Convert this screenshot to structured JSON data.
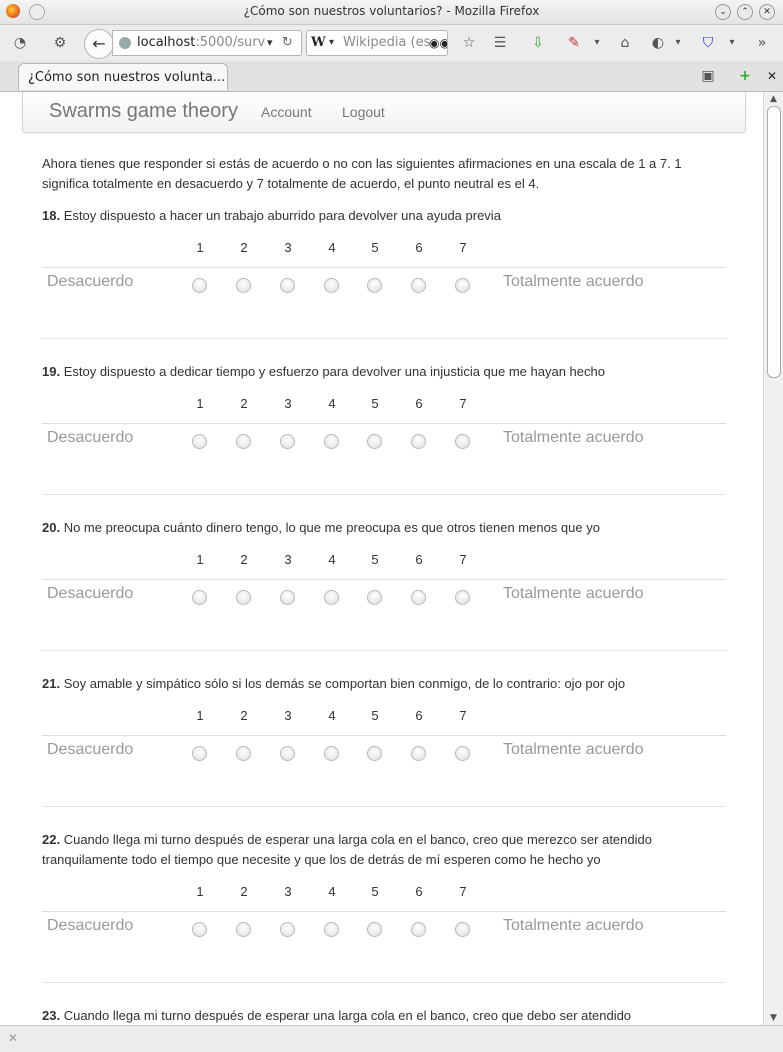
{
  "window": {
    "title": "¿Cómo son nuestros voluntarios? - Mozilla Firefox",
    "btn_min": "⌄",
    "btn_max": "⌃",
    "btn_close": "✕"
  },
  "toolbar": {
    "url_host": "localhost",
    "url_path": ":5000/surv",
    "search_engine": "W",
    "search_placeholder": "Wikipedia (es",
    "back_glyph": "←",
    "reload_glyph": "↻",
    "overflow_glyph": "»"
  },
  "tab": {
    "label": "¿Cómo son nuestros volunta...",
    "close_glyph": "✕",
    "new_tab_glyph": "+"
  },
  "app": {
    "brand": "Swarms game theory",
    "nav": [
      "Account",
      "Logout"
    ]
  },
  "intro": "Ahora tienes que responder si estás de acuerdo o no con las siguientes afirmaciones en una escala de 1 a 7. 1 significa totalmente en desacuerdo y 7 totalmente de acuerdo, el punto neutral es el 4.",
  "scale": [
    "1",
    "2",
    "3",
    "4",
    "5",
    "6",
    "7"
  ],
  "scale_left_label": "Desacuerdo",
  "scale_right_label": "Totalmente acuerdo",
  "questions": [
    {
      "number": "18.",
      "text": "Estoy dispuesto a hacer un trabajo aburrido para devolver una ayuda previa"
    },
    {
      "number": "19.",
      "text": "Estoy dispuesto a dedicar tiempo y esfuerzo para devolver una injusticia que me hayan hecho"
    },
    {
      "number": "20.",
      "text": "No me preocupa cuánto dinero tengo, lo que me preocupa es que otros tienen menos que yo"
    },
    {
      "number": "21.",
      "text": "Soy amable y simpático sólo si los demás se comportan bien conmigo, de lo contrario: ojo por ojo"
    },
    {
      "number": "22.",
      "text": "Cuando llega mi turno después de esperar una larga cola en el banco, creo que merezco ser atendido tranquilamente todo el tiempo que necesite y que los de detrás de mí esperen como he hecho yo"
    },
    {
      "number": "23.",
      "text": "Cuando llega mi turno después de esperar una larga cola en el banco, creo que debo ser atendido"
    }
  ],
  "statusbar": {
    "close_glyph": "✕"
  }
}
